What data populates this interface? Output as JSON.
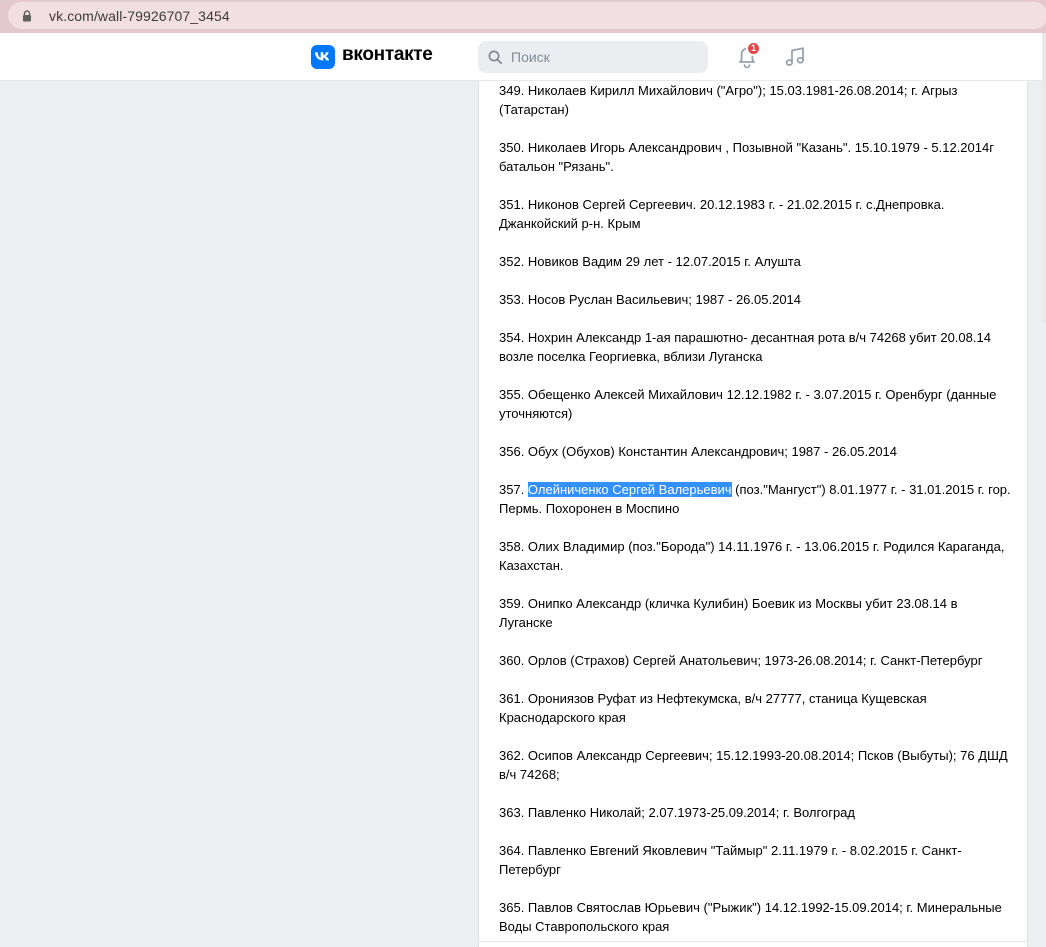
{
  "browser": {
    "url": "vk.com/wall-79926707_3454"
  },
  "header": {
    "brand": "вконтакте",
    "search_placeholder": "Поиск",
    "notification_count": "1"
  },
  "post": {
    "entries": [
      "349. Николаев Кирилл Михайлович (\"Агро\"); 15.03.1981-26.08.2014; г. Агрыз (Татарстан)",
      "350. Николаев Игорь Александрович , Позывной \"Казань\". 15.10.1979 - 5.12.2014г батальон \"Рязань\".",
      "351. Никонов Сергей Сергеевич. 20.12.1983 г. - 21.02.2015 г. с.Днепровка. Джанкойский р-н. Крым",
      "352. Новиков Вадим 29 лет - 12.07.2015 г. Алушта",
      "353. Носов Руслан Васильевич; 1987 - 26.05.2014",
      "354. Нохрин Александр 1-ая парашютно- десантная рота в/ч 74268 убит 20.08.14 возле поселка Георгиевка, вблизи Луганска",
      "355. Обещенко Алексей Михайлович 12.12.1982 г. - 3.07.2015 г. Оренбург (данные уточняются)",
      "356. Обух (Обухов) Константин Александрович; 1987 - 26.05.2014",
      "HIGHLIGHT",
      "358. Олих Владимир (поз.\"Борода\") 14.11.1976 г. - 13.06.2015 г. Родился Караганда, Казахстан.",
      "359. Онипко Александр (кличка Кулибин) Боевик из Москвы убит 23.08.14 в Луганске",
      "360. Орлов (Страхов) Сергей Анатольевич; 1973-26.08.2014; г. Санкт-Петербург",
      "361. Орониязов Руфат из Нефтекумска, в/ч 27777, станица Кущевская Краснодарского края",
      "362. Осипов Александр Сергеевич; 15.12.1993-20.08.2014; Псков (Выбуты); 76 ДШД в/ч 74268;",
      "363. Павленко Николай; 2.07.1973-25.09.2014; г. Волгоград",
      "364. Павленко Евгений Яковлевич \"Таймыр\" 2.11.1979 г. - 8.02.2015 г. Санкт-Петербург",
      "365. Павлов Святослав Юрьевич (\"Рыжик\") 14.12.1992-15.09.2014; г. Минеральные Воды Ставропольского края"
    ],
    "highlight": {
      "prefix": "357. ",
      "selected": "Олейниченко Сергей Валерьевич",
      "suffix": " (поз.\"Мангуст\") 8.01.1977 г. - 31.01.2015 г. гор. Пермь. Похоронен в Моспино"
    }
  }
}
